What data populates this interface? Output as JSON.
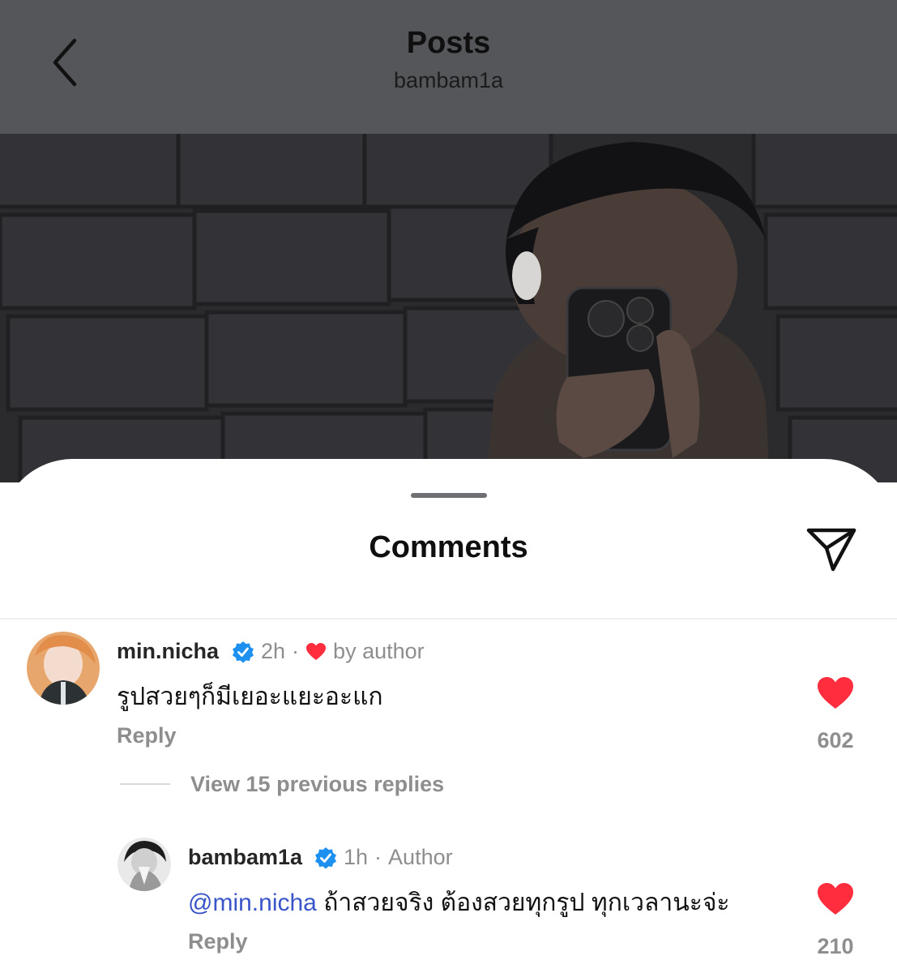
{
  "header": {
    "title": "Posts",
    "username": "bambam1a",
    "back_icon": "chevron-left-icon"
  },
  "sheet": {
    "title": "Comments",
    "share_icon": "send-icon"
  },
  "comments": [
    {
      "username": "min.nicha",
      "time": "2h",
      "separator": "·",
      "liked_label": "by author",
      "text": "รูปสวยๆก็มีเยอะแยะอะแก",
      "reply_label": "Reply",
      "likes": "602"
    }
  ],
  "view_replies": "View 15 previous replies",
  "replies": [
    {
      "username": "bambam1a",
      "time": "1h",
      "separator": "·",
      "role": "Author",
      "mention": "@min.nicha",
      "text": " ถ้าสวยจริง ต้องสวยทุกรูป ทุกเวลานะจ่ะ",
      "reply_label": "Reply",
      "likes": "210"
    }
  ],
  "colors": {
    "header_bg": "#545659",
    "heart": "#ff2d3d",
    "verified": "#1e90f0",
    "mention": "#3a55c8",
    "muted": "#8e8e8e"
  }
}
